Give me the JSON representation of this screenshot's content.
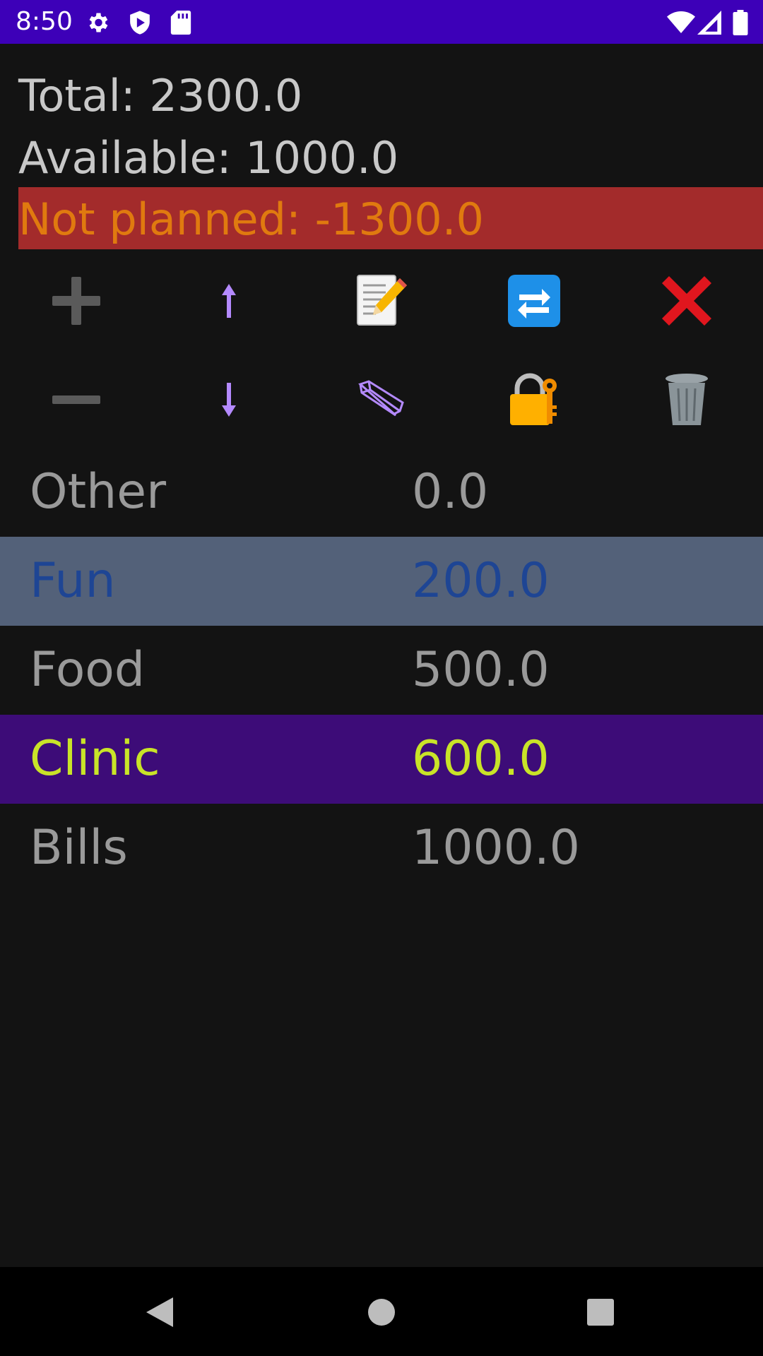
{
  "status_bar": {
    "time": "8:50",
    "left_icons": [
      "gear-icon",
      "play-protect-icon",
      "sd-card-icon"
    ],
    "right_icons": [
      "wifi-icon",
      "signal-icon",
      "battery-icon"
    ],
    "background": "#3d00b8"
  },
  "summary": {
    "total": "Total: 2300.0",
    "available": "Available: 1000.0",
    "not_planned": "Not planned: -1300.0"
  },
  "toolbar": {
    "row1": [
      "plus-icon",
      "arrow-up-icon",
      "memo-icon",
      "repeat-icon",
      "cross-mark-icon"
    ],
    "row2": [
      "minus-icon",
      "arrow-down-icon",
      "pencil-icon",
      "lock-key-icon",
      "trash-icon"
    ]
  },
  "categories": [
    {
      "name": "Other",
      "value": "0.0"
    },
    {
      "name": "Fun",
      "value": "200.0"
    },
    {
      "name": "Food",
      "value": "500.0"
    },
    {
      "name": "Clinic",
      "value": "600.0"
    },
    {
      "name": "Bills",
      "value": "1000.0"
    }
  ],
  "colors": {
    "background": "#131313",
    "not_planned_bg": "#a32b2b",
    "not_planned_text": "#e07a0f",
    "fun_row_bg": "#536179",
    "fun_row_text": "#1e4594",
    "clinic_row_bg": "#3d0c78",
    "clinic_row_text": "#c9e428",
    "default_row_text": "#9a9a9a"
  },
  "nav": [
    "back-icon",
    "home-icon",
    "recents-icon"
  ]
}
